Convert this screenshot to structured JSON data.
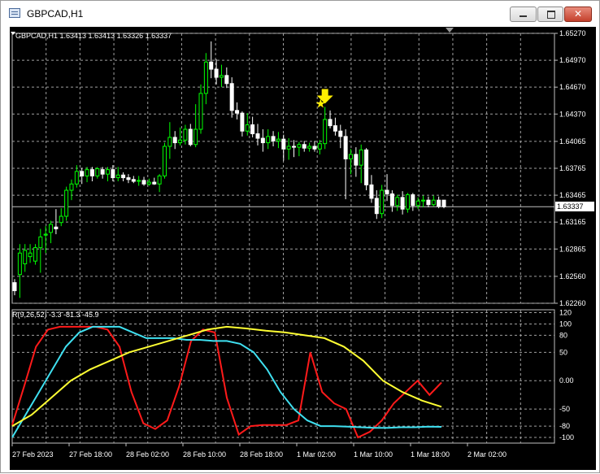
{
  "window": {
    "title": "GBPCAD,H1",
    "min_label": "–",
    "max_label": "□",
    "close_label": "✕"
  },
  "main_chart": {
    "header": "GBPCAD,H1  1.63413 1.63413 1.63326 1.63337",
    "current_price": "1.63337",
    "price_ticks": [
      "1.65270",
      "1.64970",
      "1.64670",
      "1.64370",
      "1.64065",
      "1.63765",
      "1.63465",
      "1.63165",
      "1.62865",
      "1.62560",
      "1.62260"
    ],
    "signal_icons": [
      "star-icon",
      "arrow-down-icon"
    ]
  },
  "indicator": {
    "header": "R(9,26,52) -3.3 -81.3 -45.9",
    "ticks": [
      "120",
      "100",
      "80",
      "50",
      "0.00",
      "-50",
      "-80",
      "-100"
    ]
  },
  "time_labels": [
    "27 Feb 2023",
    "27 Feb 18:00",
    "28 Feb 02:00",
    "28 Feb 10:00",
    "28 Feb 18:00",
    "1 Mar 02:00",
    "1 Mar 10:00",
    "1 Mar 18:00",
    "2 Mar 02:00"
  ],
  "colors": {
    "bull_candle": "#00ff00",
    "bear_candle": "#ffffff",
    "grid": "#a0a0a0",
    "line_red": "#ff1a1a",
    "line_cyan": "#3fe0f0",
    "line_yellow": "#ffff33",
    "signal": "#ffee00"
  },
  "chart_data": {
    "type": "candlestick",
    "symbol": "GBPCAD",
    "timeframe": "H1",
    "ylim": [
      1.6226,
      1.6527
    ],
    "candles": [
      {
        "o": 1.6249,
        "h": 1.6253,
        "l": 1.6235,
        "c": 1.624
      },
      {
        "o": 1.6258,
        "h": 1.6292,
        "l": 1.6232,
        "c": 1.6282
      },
      {
        "o": 1.627,
        "h": 1.6292,
        "l": 1.6261,
        "c": 1.6285
      },
      {
        "o": 1.6278,
        "h": 1.6292,
        "l": 1.6271,
        "c": 1.6282
      },
      {
        "o": 1.6273,
        "h": 1.6292,
        "l": 1.6269,
        "c": 1.6288
      },
      {
        "o": 1.6288,
        "h": 1.6309,
        "l": 1.626,
        "c": 1.63
      },
      {
        "o": 1.6302,
        "h": 1.6312,
        "l": 1.6282,
        "c": 1.6303
      },
      {
        "o": 1.6305,
        "h": 1.6318,
        "l": 1.6293,
        "c": 1.6314
      },
      {
        "o": 1.6311,
        "h": 1.6331,
        "l": 1.6303,
        "c": 1.6309
      },
      {
        "o": 1.6316,
        "h": 1.6332,
        "l": 1.6312,
        "c": 1.6323
      },
      {
        "o": 1.6323,
        "h": 1.6356,
        "l": 1.6318,
        "c": 1.6352
      },
      {
        "o": 1.6352,
        "h": 1.6364,
        "l": 1.6341,
        "c": 1.6359
      },
      {
        "o": 1.6359,
        "h": 1.638,
        "l": 1.6355,
        "c": 1.6373
      },
      {
        "o": 1.6373,
        "h": 1.6377,
        "l": 1.6359,
        "c": 1.6368
      },
      {
        "o": 1.6368,
        "h": 1.6378,
        "l": 1.6361,
        "c": 1.6375
      },
      {
        "o": 1.6375,
        "h": 1.6378,
        "l": 1.6362,
        "c": 1.6368
      },
      {
        "o": 1.6368,
        "h": 1.6378,
        "l": 1.6365,
        "c": 1.6376
      },
      {
        "o": 1.6375,
        "h": 1.6378,
        "l": 1.6365,
        "c": 1.637
      },
      {
        "o": 1.637,
        "h": 1.6378,
        "l": 1.6362,
        "c": 1.6375
      },
      {
        "o": 1.6375,
        "h": 1.638,
        "l": 1.6362,
        "c": 1.6366
      },
      {
        "o": 1.6366,
        "h": 1.6378,
        "l": 1.6362,
        "c": 1.6369
      },
      {
        "o": 1.6369,
        "h": 1.6372,
        "l": 1.6362,
        "c": 1.6366
      },
      {
        "o": 1.6366,
        "h": 1.637,
        "l": 1.636,
        "c": 1.6364
      },
      {
        "o": 1.6364,
        "h": 1.6368,
        "l": 1.636,
        "c": 1.6362
      },
      {
        "o": 1.6362,
        "h": 1.6368,
        "l": 1.6357,
        "c": 1.6363
      },
      {
        "o": 1.6363,
        "h": 1.6367,
        "l": 1.6357,
        "c": 1.6359
      },
      {
        "o": 1.6359,
        "h": 1.6365,
        "l": 1.6357,
        "c": 1.6361
      },
      {
        "o": 1.6361,
        "h": 1.6366,
        "l": 1.6358,
        "c": 1.6359
      },
      {
        "o": 1.6359,
        "h": 1.637,
        "l": 1.635,
        "c": 1.6368
      },
      {
        "o": 1.6368,
        "h": 1.6405,
        "l": 1.6365,
        "c": 1.6401
      },
      {
        "o": 1.6401,
        "h": 1.6428,
        "l": 1.6387,
        "c": 1.6411
      },
      {
        "o": 1.6411,
        "h": 1.6418,
        "l": 1.6398,
        "c": 1.6405
      },
      {
        "o": 1.6405,
        "h": 1.6422,
        "l": 1.6402,
        "c": 1.6408
      },
      {
        "o": 1.6408,
        "h": 1.6425,
        "l": 1.6403,
        "c": 1.642
      },
      {
        "o": 1.642,
        "h": 1.6426,
        "l": 1.6401,
        "c": 1.6403
      },
      {
        "o": 1.6403,
        "h": 1.6448,
        "l": 1.64,
        "c": 1.642
      },
      {
        "o": 1.642,
        "h": 1.647,
        "l": 1.6415,
        "c": 1.646
      },
      {
        "o": 1.646,
        "h": 1.6505,
        "l": 1.6448,
        "c": 1.6495
      },
      {
        "o": 1.6495,
        "h": 1.6518,
        "l": 1.6477,
        "c": 1.6487
      },
      {
        "o": 1.6487,
        "h": 1.6498,
        "l": 1.647,
        "c": 1.6478
      },
      {
        "o": 1.6478,
        "h": 1.6492,
        "l": 1.6467,
        "c": 1.648
      },
      {
        "o": 1.648,
        "h": 1.6489,
        "l": 1.6466,
        "c": 1.6471
      },
      {
        "o": 1.6471,
        "h": 1.6478,
        "l": 1.6433,
        "c": 1.6441
      },
      {
        "o": 1.6441,
        "h": 1.645,
        "l": 1.6431,
        "c": 1.6438
      },
      {
        "o": 1.6438,
        "h": 1.644,
        "l": 1.6412,
        "c": 1.6418
      },
      {
        "o": 1.6418,
        "h": 1.6438,
        "l": 1.6413,
        "c": 1.6425
      },
      {
        "o": 1.6425,
        "h": 1.6434,
        "l": 1.6411,
        "c": 1.6415
      },
      {
        "o": 1.6415,
        "h": 1.6426,
        "l": 1.6402,
        "c": 1.641
      },
      {
        "o": 1.641,
        "h": 1.642,
        "l": 1.6395,
        "c": 1.6405
      },
      {
        "o": 1.6405,
        "h": 1.642,
        "l": 1.6398,
        "c": 1.6412
      },
      {
        "o": 1.6412,
        "h": 1.6418,
        "l": 1.6401,
        "c": 1.6407
      },
      {
        "o": 1.6407,
        "h": 1.6417,
        "l": 1.6399,
        "c": 1.6409
      },
      {
        "o": 1.6409,
        "h": 1.6414,
        "l": 1.6385,
        "c": 1.6398
      },
      {
        "o": 1.6398,
        "h": 1.641,
        "l": 1.6386,
        "c": 1.6401
      },
      {
        "o": 1.6401,
        "h": 1.6408,
        "l": 1.6389,
        "c": 1.64
      },
      {
        "o": 1.64,
        "h": 1.6406,
        "l": 1.639,
        "c": 1.6403
      },
      {
        "o": 1.6403,
        "h": 1.6407,
        "l": 1.6395,
        "c": 1.6399
      },
      {
        "o": 1.6399,
        "h": 1.6405,
        "l": 1.6395,
        "c": 1.6401
      },
      {
        "o": 1.6401,
        "h": 1.6407,
        "l": 1.6395,
        "c": 1.6398
      },
      {
        "o": 1.6398,
        "h": 1.6408,
        "l": 1.6392,
        "c": 1.6404
      },
      {
        "o": 1.6404,
        "h": 1.6445,
        "l": 1.6398,
        "c": 1.6431
      },
      {
        "o": 1.6431,
        "h": 1.6441,
        "l": 1.6421,
        "c": 1.6424
      },
      {
        "o": 1.6424,
        "h": 1.6433,
        "l": 1.6413,
        "c": 1.6418
      },
      {
        "o": 1.6418,
        "h": 1.6425,
        "l": 1.6399,
        "c": 1.6412
      },
      {
        "o": 1.6412,
        "h": 1.642,
        "l": 1.6342,
        "c": 1.6387
      },
      {
        "o": 1.6387,
        "h": 1.6398,
        "l": 1.637,
        "c": 1.6392
      },
      {
        "o": 1.6392,
        "h": 1.64,
        "l": 1.6367,
        "c": 1.638
      },
      {
        "o": 1.638,
        "h": 1.6403,
        "l": 1.636,
        "c": 1.6397
      },
      {
        "o": 1.6397,
        "h": 1.6399,
        "l": 1.6352,
        "c": 1.6358
      },
      {
        "o": 1.6358,
        "h": 1.6369,
        "l": 1.6338,
        "c": 1.6343
      },
      {
        "o": 1.6343,
        "h": 1.6352,
        "l": 1.632,
        "c": 1.6326
      },
      {
        "o": 1.6326,
        "h": 1.6358,
        "l": 1.6321,
        "c": 1.6352
      },
      {
        "o": 1.6352,
        "h": 1.637,
        "l": 1.634,
        "c": 1.6348
      },
      {
        "o": 1.6348,
        "h": 1.6352,
        "l": 1.6328,
        "c": 1.6335
      },
      {
        "o": 1.6335,
        "h": 1.6347,
        "l": 1.6329,
        "c": 1.6344
      },
      {
        "o": 1.6344,
        "h": 1.6351,
        "l": 1.6325,
        "c": 1.6331
      },
      {
        "o": 1.6331,
        "h": 1.6349,
        "l": 1.6327,
        "c": 1.6347
      },
      {
        "o": 1.6347,
        "h": 1.6349,
        "l": 1.6329,
        "c": 1.6335
      },
      {
        "o": 1.6335,
        "h": 1.6344,
        "l": 1.6331,
        "c": 1.634
      },
      {
        "o": 1.634,
        "h": 1.6346,
        "l": 1.6333,
        "c": 1.6341
      },
      {
        "o": 1.6341,
        "h": 1.6345,
        "l": 1.6333,
        "c": 1.6336
      },
      {
        "o": 1.6336,
        "h": 1.6346,
        "l": 1.6334,
        "c": 1.6341
      },
      {
        "o": 1.6341,
        "h": 1.6345,
        "l": 1.6332,
        "c": 1.6334
      },
      {
        "o": 1.6341,
        "h": 1.6341,
        "l": 1.6332,
        "c": 1.63337
      }
    ],
    "indicator": {
      "name": "R(9,26,52)",
      "ylim": [
        -110,
        125
      ],
      "series": [
        {
          "color": "#ff1a1a",
          "values": [
            -78,
            -10,
            60,
            90,
            95,
            95,
            95,
            95,
            90,
            60,
            -20,
            -75,
            -85,
            -70,
            -10,
            70,
            90,
            85,
            -30,
            -95,
            -80,
            -78,
            -78,
            -78,
            -70,
            50,
            -20,
            -40,
            -50,
            -100,
            -90,
            -70,
            -40,
            -20,
            0,
            -25,
            -3.3
          ]
        },
        {
          "color": "#3fe0f0",
          "values": [
            -100,
            -60,
            -20,
            20,
            60,
            85,
            95,
            95,
            95,
            85,
            75,
            75,
            75,
            72,
            72,
            70,
            70,
            65,
            50,
            20,
            -20,
            -50,
            -70,
            -80,
            -80,
            -81,
            -82,
            -83,
            -83,
            -82,
            -82,
            -81,
            -81.3
          ]
        },
        {
          "color": "#ffff33",
          "values": [
            -80,
            -60,
            -30,
            0,
            20,
            35,
            50,
            60,
            70,
            80,
            90,
            95,
            92,
            88,
            85,
            80,
            75,
            60,
            35,
            0,
            -20,
            -35,
            -45.9
          ]
        }
      ]
    }
  }
}
